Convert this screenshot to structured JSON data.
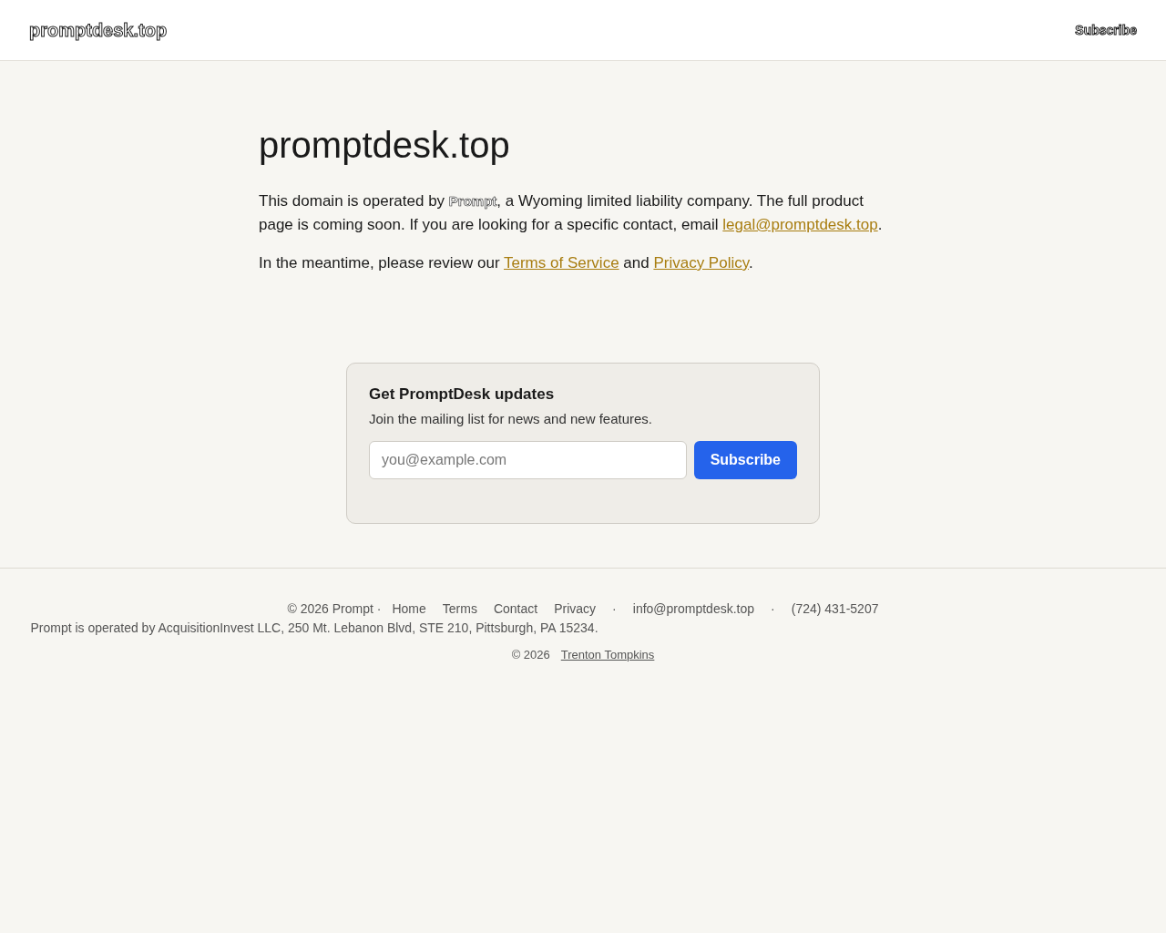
{
  "header": {
    "logo": "promptdesk.top",
    "subscribe_link": "Subscribe"
  },
  "hero": {
    "title": "promptdesk.top",
    "paragraphs": [
      [
        {
          "kind": "text",
          "text": "This domain is operated by **Prompt**, a Wyoming limited liability company. The full product page is coming soon. If you are looking for a specific contact, email "
        },
        {
          "kind": "link",
          "text": "legal@promptdesk.top"
        },
        {
          "kind": "text",
          "text": "."
        }
      ],
      [
        {
          "kind": "text",
          "text": "In the meantime, please review our "
        },
        {
          "kind": "link",
          "text": "Terms of Service"
        },
        {
          "kind": "text",
          "text": " and "
        },
        {
          "kind": "link",
          "text": "Privacy Policy"
        },
        {
          "kind": "text",
          "text": "."
        }
      ]
    ]
  },
  "signup": {
    "title": "Get PromptDesk updates",
    "subtitle": "Join the mailing list for news and new features.",
    "email": {
      "placeholder": "you@example.com"
    },
    "button": "Subscribe"
  },
  "footer": {
    "copyright": "© 2026 Prompt ·",
    "links": [
      "Home",
      "Terms",
      "Contact",
      "Privacy"
    ],
    "separator": "·",
    "email": "info@promptdesk.top",
    "separator_2": "·",
    "phone": "(724) 431-5207",
    "operator": "Prompt is operated by AcquisitionInvest LLC, 250 Mt. Lebanon Blvd, STE 210, Pittsburgh, PA 15234.",
    "credit_year": "© 2026",
    "credit_name": "Trenton Tompkins"
  }
}
